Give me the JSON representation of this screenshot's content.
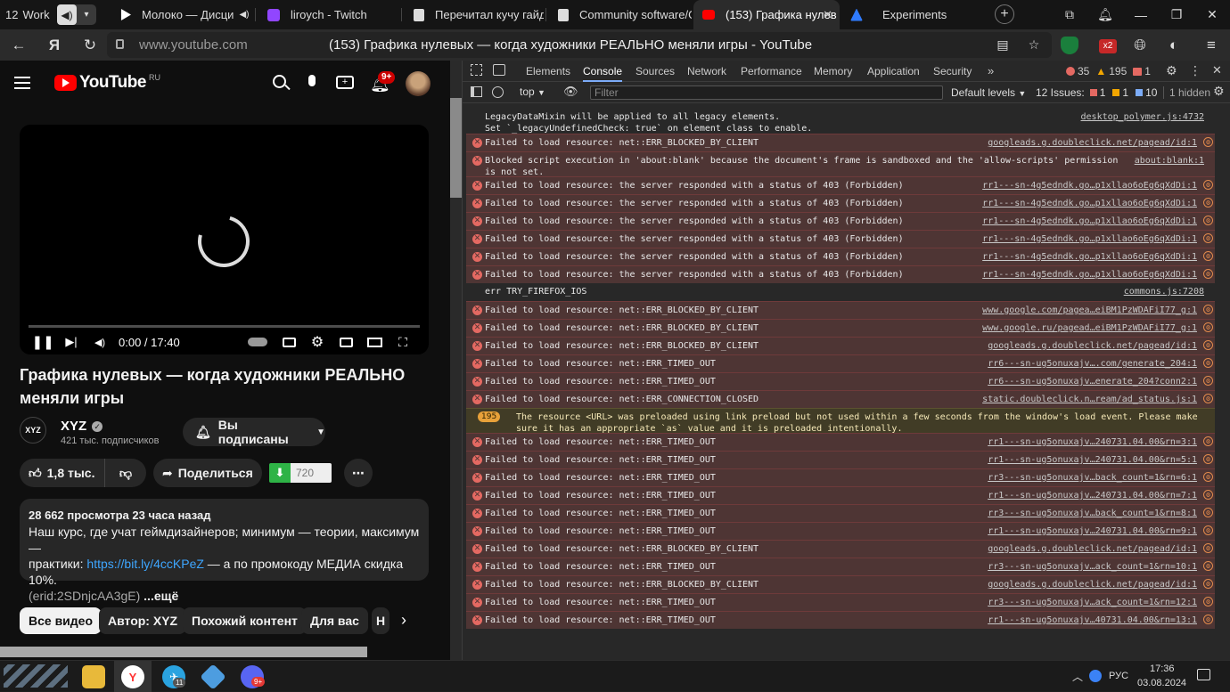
{
  "browser": {
    "workspace_badge": "12",
    "workspace_label": "Work",
    "tabs": [
      {
        "label": "Молоко — Дисци",
        "icon_color": "#ffffff"
      },
      {
        "label": "liroych - Twitch",
        "icon_color": "#9146ff"
      },
      {
        "label": "Перечитал кучу гайдо",
        "icon_color": "#ffffff"
      },
      {
        "label": "Community software/G",
        "icon_color": "#ffffff"
      },
      {
        "label": "(153) Графика нулев",
        "icon_color": "#ff0000"
      },
      {
        "label": "Experiments",
        "icon_color": "#2f7bff"
      }
    ],
    "url": "www.youtube.com",
    "page_title": "(153) Графика нулевых — когда художники РЕАЛЬНО меняли игры - YouTube",
    "ext_badge": "x2"
  },
  "youtube": {
    "logo_text": "YouTube",
    "region": "RU",
    "notif_count": "9+",
    "player": {
      "time": "0:00 / 17:40"
    },
    "video_title": "Графика нулевых — когда художники РЕАЛЬНО меняли игры",
    "channel": {
      "logo": "XYZ",
      "name": "XYZ",
      "subs": "421 тыс. подписчиков",
      "subscribed_label": "Вы подписаны"
    },
    "likes": "1,8 тыс.",
    "share_label": "Поделиться",
    "download_label": "720",
    "description": {
      "stats": "28 662 просмотра  23 часа назад",
      "line1": "Наш курс, где учат геймдизайнеров; минимум — теории, максимум —",
      "line2_prefix": "практики: ",
      "link": "https://bit.ly/4ccKPeZ",
      "line2_suffix": " — а по промокоду МЕДИА скидка 10%.",
      "line3": "(erid:2SDnjcAA3gE)",
      "more": "...ещё"
    },
    "chips": [
      "Все видео",
      "Автор: XYZ",
      "Похожий контент",
      "Для вас",
      "Н"
    ]
  },
  "devtools": {
    "tabs": [
      "Elements",
      "Console",
      "Sources",
      "Network",
      "Performance",
      "Memory",
      "Application",
      "Security"
    ],
    "active_tab": "Console",
    "counts": {
      "errors": "35",
      "warnings": "195",
      "info": "1"
    },
    "context": "top",
    "filter_placeholder": "Filter",
    "levels": "Default levels",
    "issues_label": "12 Issues:",
    "issues": {
      "errors": "1",
      "warnings": "1",
      "info": "10"
    },
    "hidden": "1 hidden",
    "logs": [
      {
        "type": "info",
        "msg": "LegacyDataMixin will be applied to all legacy elements.\nSet `_legacyUndefinedCheck: true` on element class to enable.",
        "src": "desktop_polymer.js:4732",
        "lines": 2
      },
      {
        "type": "error",
        "msg": "Failed to load resource: net::ERR_BLOCKED_BY_CLIENT",
        "src": "googleads.g.doubleclick.net/pagead/id:1",
        "lines": 1
      },
      {
        "type": "error",
        "msg": "Blocked script execution in 'about:blank' because the document's frame is sandboxed and the 'allow-scripts' permission\nis not set.",
        "src": "about:blank:1",
        "lines": 2
      },
      {
        "type": "error",
        "msg": "Failed to load resource: the server responded with a status of 403 (Forbidden)",
        "src": "rr1---sn-4g5edndk.go…p1xllao6oEg6qXdDi:1",
        "lines": 1
      },
      {
        "type": "error",
        "msg": "Failed to load resource: the server responded with a status of 403 (Forbidden)",
        "src": "rr1---sn-4g5edndk.go…p1xllao6oEg6qXdDi:1",
        "lines": 1
      },
      {
        "type": "error",
        "msg": "Failed to load resource: the server responded with a status of 403 (Forbidden)",
        "src": "rr1---sn-4g5edndk.go…p1xllao6oEg6qXdDi:1",
        "lines": 1
      },
      {
        "type": "error",
        "msg": "Failed to load resource: the server responded with a status of 403 (Forbidden)",
        "src": "rr1---sn-4g5edndk.go…p1xllao6oEg6qXdDi:1",
        "lines": 1
      },
      {
        "type": "error",
        "msg": "Failed to load resource: the server responded with a status of 403 (Forbidden)",
        "src": "rr1---sn-4g5edndk.go…p1xllao6oEg6qXdDi:1",
        "lines": 1
      },
      {
        "type": "error",
        "msg": "Failed to load resource: the server responded with a status of 403 (Forbidden)",
        "src": "rr1---sn-4g5edndk.go…p1xllao6oEg6qXdDi:1",
        "lines": 1
      },
      {
        "type": "info",
        "msg": "err TRY_FIREFOX_IOS",
        "src": "commons.js:7208",
        "lines": 1
      },
      {
        "type": "error",
        "msg": "Failed to load resource: net::ERR_BLOCKED_BY_CLIENT",
        "src": "www.google.com/pagea…eiBM1PzWDAFiI77_g:1",
        "lines": 1
      },
      {
        "type": "error",
        "msg": "Failed to load resource: net::ERR_BLOCKED_BY_CLIENT",
        "src": "www.google.ru/pagead…eiBM1PzWDAFiI77_g:1",
        "lines": 1
      },
      {
        "type": "error",
        "msg": "Failed to load resource: net::ERR_BLOCKED_BY_CLIENT",
        "src": "googleads.g.doubleclick.net/pagead/id:1",
        "lines": 1
      },
      {
        "type": "error",
        "msg": "Failed to load resource: net::ERR_TIMED_OUT",
        "src": "rr6---sn-ug5onuxajv….com/generate_204:1",
        "lines": 1
      },
      {
        "type": "error",
        "msg": "Failed to load resource: net::ERR_TIMED_OUT",
        "src": "rr6---sn-ug5onuxajv…enerate_204?conn2:1",
        "lines": 1
      },
      {
        "type": "error",
        "msg": "Failed to load resource: net::ERR_CONNECTION_CLOSED",
        "src": "static.doubleclick.n…ream/ad_status.js:1",
        "lines": 1
      },
      {
        "type": "warn",
        "badge": "195",
        "msg": "The resource <URL> was preloaded using link preload but not used within a few seconds from the window's load event. Please make\nsure it has an appropriate `as` value and it is preloaded intentionally.",
        "src": "",
        "lines": 2
      },
      {
        "type": "error",
        "msg": "Failed to load resource: net::ERR_TIMED_OUT",
        "src": "rr1---sn-ug5onuxajv…240731.04.00&rn=3:1",
        "lines": 1
      },
      {
        "type": "error",
        "msg": "Failed to load resource: net::ERR_TIMED_OUT",
        "src": "rr1---sn-ug5onuxajv…240731.04.00&rn=5:1",
        "lines": 1
      },
      {
        "type": "error",
        "msg": "Failed to load resource: net::ERR_TIMED_OUT",
        "src": "rr3---sn-ug5onuxajv…back_count=1&rn=6:1",
        "lines": 1
      },
      {
        "type": "error",
        "msg": "Failed to load resource: net::ERR_TIMED_OUT",
        "src": "rr1---sn-ug5onuxajv…240731.04.00&rn=7:1",
        "lines": 1
      },
      {
        "type": "error",
        "msg": "Failed to load resource: net::ERR_TIMED_OUT",
        "src": "rr3---sn-ug5onuxajv…back_count=1&rn=8:1",
        "lines": 1
      },
      {
        "type": "error",
        "msg": "Failed to load resource: net::ERR_TIMED_OUT",
        "src": "rr1---sn-ug5onuxajv…240731.04.00&rn=9:1",
        "lines": 1
      },
      {
        "type": "error",
        "msg": "Failed to load resource: net::ERR_BLOCKED_BY_CLIENT",
        "src": "googleads.g.doubleclick.net/pagead/id:1",
        "lines": 1
      },
      {
        "type": "error",
        "msg": "Failed to load resource: net::ERR_TIMED_OUT",
        "src": "rr3---sn-ug5onuxajv…ack_count=1&rn=10:1",
        "lines": 1
      },
      {
        "type": "error",
        "msg": "Failed to load resource: net::ERR_BLOCKED_BY_CLIENT",
        "src": "googleads.g.doubleclick.net/pagead/id:1",
        "lines": 1
      },
      {
        "type": "error",
        "msg": "Failed to load resource: net::ERR_TIMED_OUT",
        "src": "rr3---sn-ug5onuxajv…ack_count=1&rn=12:1",
        "lines": 1
      },
      {
        "type": "error",
        "msg": "Failed to load resource: net::ERR_TIMED_OUT",
        "src": "rr1---sn-ug5onuxajv…40731.04.00&rn=13:1",
        "lines": 1
      }
    ]
  },
  "taskbar": {
    "language": "РУС",
    "time": "17:36",
    "date": "03.08.2024",
    "telegram_badge": "11",
    "discord_badge": "9+"
  }
}
